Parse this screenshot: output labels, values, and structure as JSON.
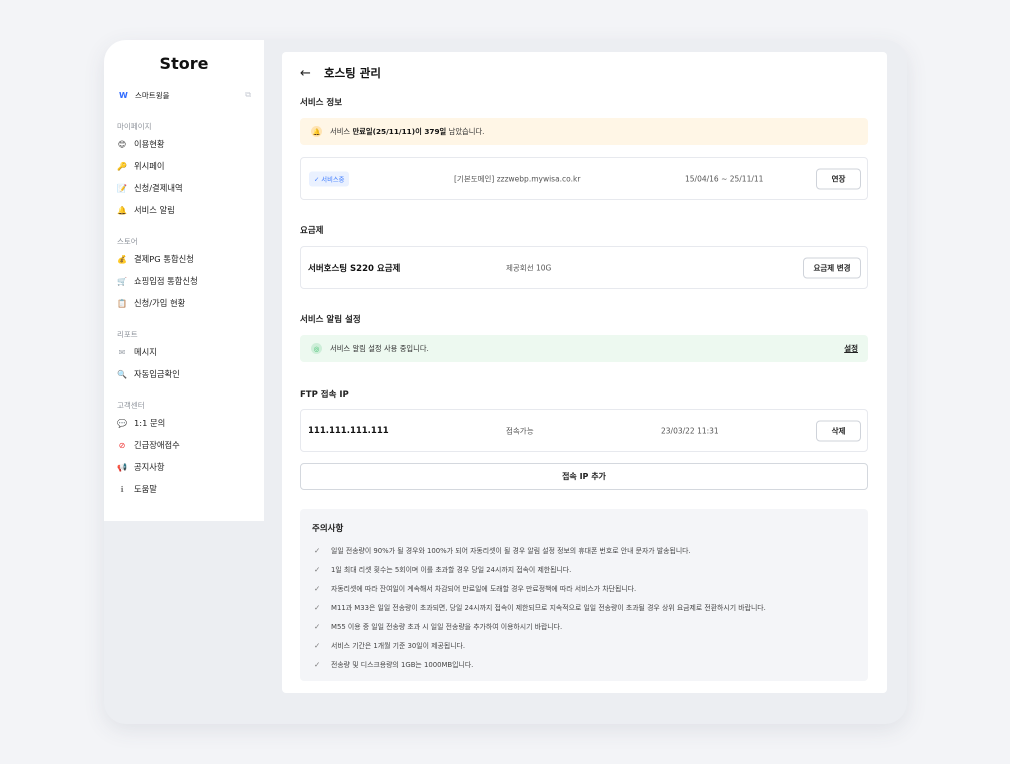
{
  "sidebar": {
    "logo": "Store",
    "smart": {
      "icon": "W",
      "label": "스마트윙을"
    },
    "sections": {
      "mypage": "마이페이지",
      "store": "스토어",
      "report": "리포트",
      "support": "고객센터"
    },
    "items": [
      {
        "label": "이용현황",
        "icon": "😊"
      },
      {
        "label": "위시페이",
        "icon": "🔑"
      },
      {
        "label": "신청/결제내역",
        "icon": "📝"
      },
      {
        "label": "서비스 알림",
        "icon": "🔔"
      },
      {
        "label": "결제PG 통합신청",
        "icon": "💰"
      },
      {
        "label": "쇼핑입점 통합신청",
        "icon": "🛒"
      },
      {
        "label": "신청/가입 현황",
        "icon": "📋"
      },
      {
        "label": "메시지",
        "icon": "✉"
      },
      {
        "label": "자동입금확인",
        "icon": "🔍"
      },
      {
        "label": "1:1 문의",
        "icon": "💬"
      },
      {
        "label": "긴급장애접수",
        "icon": "⊘"
      },
      {
        "label": "공지사항",
        "icon": "📢"
      },
      {
        "label": "도움말",
        "icon": "ℹ"
      }
    ]
  },
  "main": {
    "back_icon": "←",
    "title": "호스팅 관리",
    "service_info": {
      "title": "서비스 정보",
      "banner_prefix": "서비스 ",
      "banner_bold": "만료일(25/11/11)이 379일",
      "banner_suffix": " 남았습니다.",
      "status_tag": "✓ 서비스중",
      "domain": "[기본도메인] zzzwebp.mywisa.co.kr",
      "period": "15/04/16 ~ 25/11/11",
      "extend_button": "연장"
    },
    "plan": {
      "title": "요금제",
      "name": "서버호스팅 S220 요금제",
      "line": "제공회선 10G",
      "change_button": "요금제 변경"
    },
    "alert_settings": {
      "title": "서비스 알림 설정",
      "message": "서비스 알림 설정 사용 중입니다.",
      "settings_link": "설정"
    },
    "ftp": {
      "title": "FTP 접속 IP",
      "ip": "111.111.111.111",
      "status": "접속가능",
      "date": "23/03/22 11:31",
      "delete_button": "삭제",
      "add_button": "접속 IP 추가"
    },
    "notes": {
      "title": "주의사항",
      "items": [
        "일일 전송량이 90%가 될 경우와 100%가 되어 자동리셋이 될 경우 알림 설정 정보의 휴대폰 번호로 안내 문자가 발송됩니다.",
        "1일 최대 리셋 횟수는 5회이며 이를 초과할 경우 당일 24시까지 접속이 제한됩니다.",
        "자동리셋에 따라 잔여일이 계속해서 차감되어 만료일에 도래할 경우 만료정책에 따라 서비스가 차단됩니다.",
        "M11과 M33은 일일 전송량이 초과되면, 당일 24시까지 접속이 제한되므로 지속적으로 일일 전송량이 초과될 경우 상위 요금제로 전환하시기 바랍니다.",
        "M55 이용 중 일일 전송량 초과 시 일일 전송량을 추가하여 이용하시기 바랍니다.",
        "서비스 기간은 1개월 기준 30일이 제공됩니다.",
        "전송량 및 디스크용량의 1GB는 1000MB입니다."
      ]
    }
  },
  "colors": {
    "accent": "#2f6bff",
    "warning_bg": "#fff6e6",
    "success_bg": "#edf9f0",
    "warning_icon": "#f5a623",
    "success_icon": "#3cbf6b"
  }
}
